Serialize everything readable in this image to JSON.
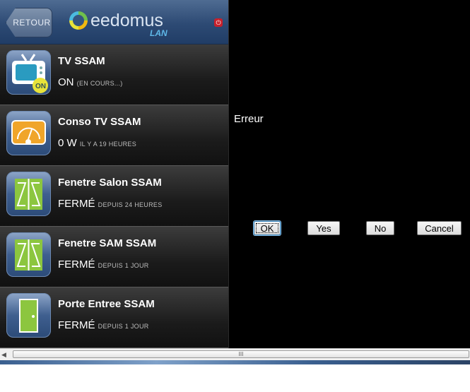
{
  "header": {
    "back_label": "RETOUR",
    "logo_text": "eedomus",
    "logo_sub": "LAN"
  },
  "devices": [
    {
      "name": "TV SSAM",
      "state": "ON",
      "sub": "(EN COURS...)",
      "icon": "tv-icon",
      "badge": "ON"
    },
    {
      "name": "Conso TV SSAM",
      "state": "0 W",
      "sub": "IL Y A 19 HEURES",
      "icon": "meter-icon"
    },
    {
      "name": "Fenetre Salon SSAM",
      "state": "FERMÉ",
      "sub": "DEPUIS 24 HEURES",
      "icon": "window-icon"
    },
    {
      "name": "Fenetre SAM SSAM",
      "state": "FERMÉ",
      "sub": "DEPUIS 1 JOUR",
      "icon": "window-icon"
    },
    {
      "name": "Porte Entree SSAM",
      "state": "FERMÉ",
      "sub": "DEPUIS 1 JOUR",
      "icon": "door-icon"
    }
  ],
  "dialog": {
    "message": "Erreur",
    "ok": "OK",
    "yes": "Yes",
    "no": "No",
    "cancel": "Cancel"
  },
  "scrollbar": {
    "thumb_grip": "III"
  }
}
